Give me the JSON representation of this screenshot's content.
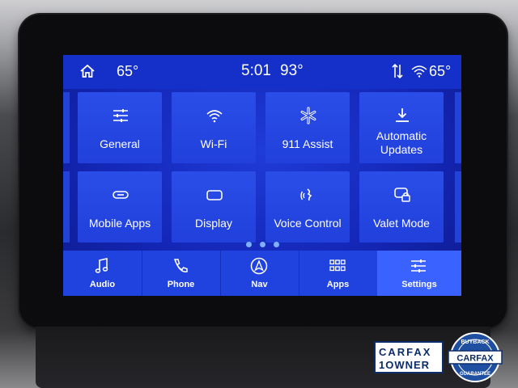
{
  "status": {
    "temp_left": "65°",
    "time": "5:01",
    "temp_center": "93°",
    "temp_right": "65°"
  },
  "tiles": [
    {
      "label": "General",
      "icon": "sliders-icon"
    },
    {
      "label": "Wi-Fi",
      "icon": "wifi-icon"
    },
    {
      "label": "911 Assist",
      "icon": "asterisk-icon"
    },
    {
      "label": "Automatic Updates",
      "icon": "download-icon"
    },
    {
      "label": "Mobile Apps",
      "icon": "link-icon"
    },
    {
      "label": "Display",
      "icon": "display-icon"
    },
    {
      "label": "Voice Control",
      "icon": "voice-icon"
    },
    {
      "label": "Valet Mode",
      "icon": "valet-icon"
    }
  ],
  "dock": [
    {
      "label": "Audio",
      "icon": "music-icon"
    },
    {
      "label": "Phone",
      "icon": "phone-icon"
    },
    {
      "label": "Nav",
      "icon": "nav-icon"
    },
    {
      "label": "Apps",
      "icon": "apps-grid-icon"
    },
    {
      "label": "Settings",
      "icon": "settings-sliders-icon"
    }
  ],
  "dock_active": "Settings",
  "watermark": {
    "line1": "CARFAX",
    "line2": "1OWNER",
    "seal_top": "BUYBACK",
    "seal_mid": "CARFAX",
    "seal_bottom": "GUARANTEE"
  },
  "colors": {
    "screen_blue": "#1427b8",
    "tile_blue": "#2a4de8",
    "active_dock": "#3a62ff"
  }
}
